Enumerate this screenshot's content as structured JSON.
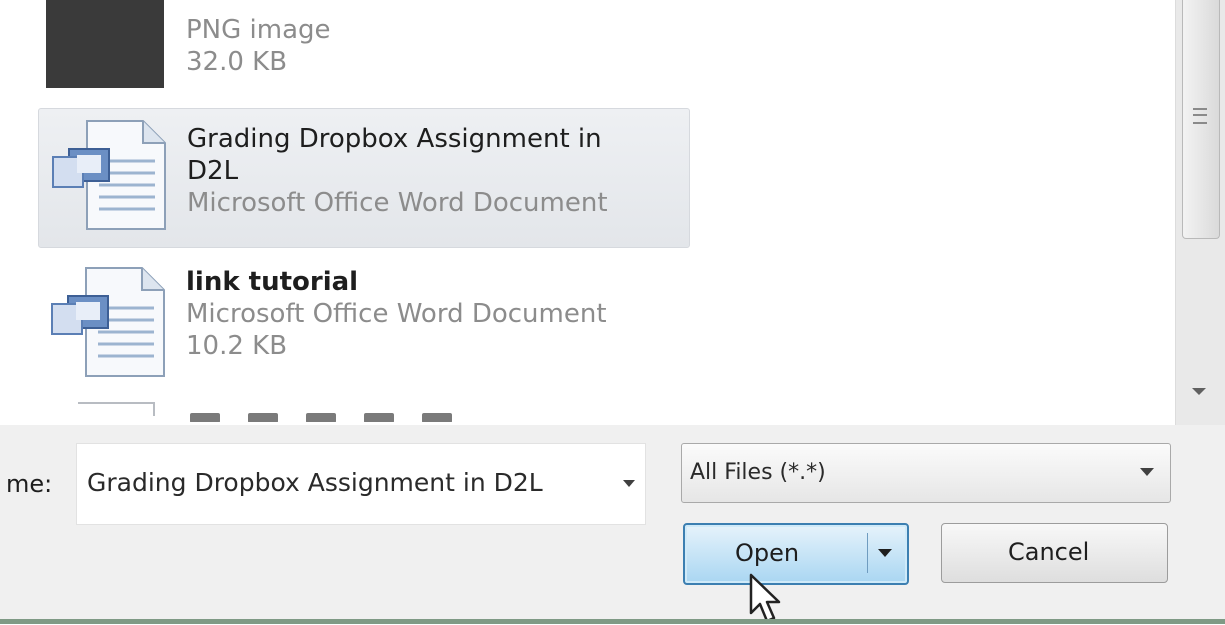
{
  "file_list": {
    "items": [
      {
        "name": "",
        "type": "PNG image",
        "size": "32.0 KB"
      },
      {
        "name_line1": "Grading Dropbox Assignment in",
        "name_line2": "D2L",
        "type": "Microsoft Office Word Document"
      },
      {
        "name": "link tutorial",
        "type": "Microsoft Office Word Document",
        "size": "10.2 KB"
      }
    ]
  },
  "file_name": {
    "label": "me:",
    "value": "Grading Dropbox Assignment in D2L"
  },
  "file_type_filter": {
    "value": "All Files (*.*)"
  },
  "buttons": {
    "open_label": "Open",
    "cancel_label": "Cancel"
  },
  "colors": {
    "selection": "#e3e6ea",
    "open_button_border": "#3c7fb1",
    "open_button_fill": "#a9d6f2",
    "meta_text": "#8c8c8c"
  },
  "icons": {
    "image_file": "png-thumbnail-icon",
    "word_file": "word-document-icon",
    "cursor": "mouse-pointer-icon"
  }
}
